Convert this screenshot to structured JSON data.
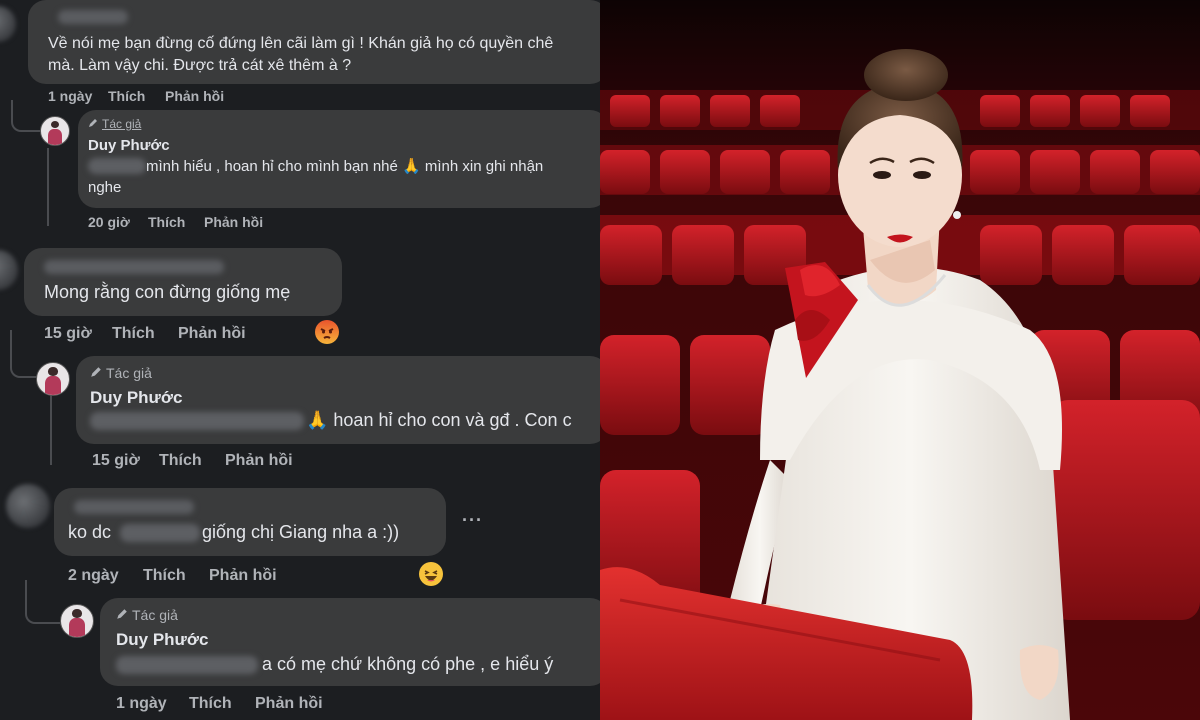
{
  "comments": [
    {
      "text": "Về nói mẹ bạn đừng cố đứng lên cãi làm gì ! Khán giả họ có quyền chê",
      "text2": "mà. Làm vậy chi. Được trả cát xê thêm à ?",
      "time": "1 ngày",
      "like": "Thích",
      "reply": "Phản hồi"
    },
    {
      "author_tag": "Tác giả",
      "author": "Duy Phước",
      "text": "mình hiểu , hoan hỉ cho mình bạn nhé 🙏 mình xin ghi nhận",
      "text2": "nghe",
      "time": "20 giờ",
      "like": "Thích",
      "reply": "Phản hồi"
    },
    {
      "text": "Mong rằng con đừng giống mẹ",
      "time": "15 giờ",
      "like": "Thích",
      "reply": "Phản hồi"
    },
    {
      "author_tag": "Tác giả",
      "author": "Duy Phước",
      "text": "🙏 hoan hỉ cho con và gđ . Con c",
      "time": "15 giờ",
      "like": "Thích",
      "reply": "Phản hồi"
    },
    {
      "text_a": "ko dc",
      "text_b": "giống chị Giang nha a :))",
      "time": "2 ngày",
      "like": "Thích",
      "reply": "Phản hồi",
      "more": "···"
    },
    {
      "author_tag": "Tác giả",
      "author": "Duy Phước",
      "text": "a có mẹ chứ không có phe , e hiểu ý",
      "time": "1 ngày",
      "like": "Thích",
      "reply": "Phản hồi"
    }
  ],
  "colors": {
    "bg": "#1c1e21",
    "bubble": "#3a3b3c",
    "text": "#e4e6eb",
    "meta": "#b0b3b8",
    "seat": "#b3161c",
    "dress": "#f2efea",
    "rose": "#c4141e"
  }
}
